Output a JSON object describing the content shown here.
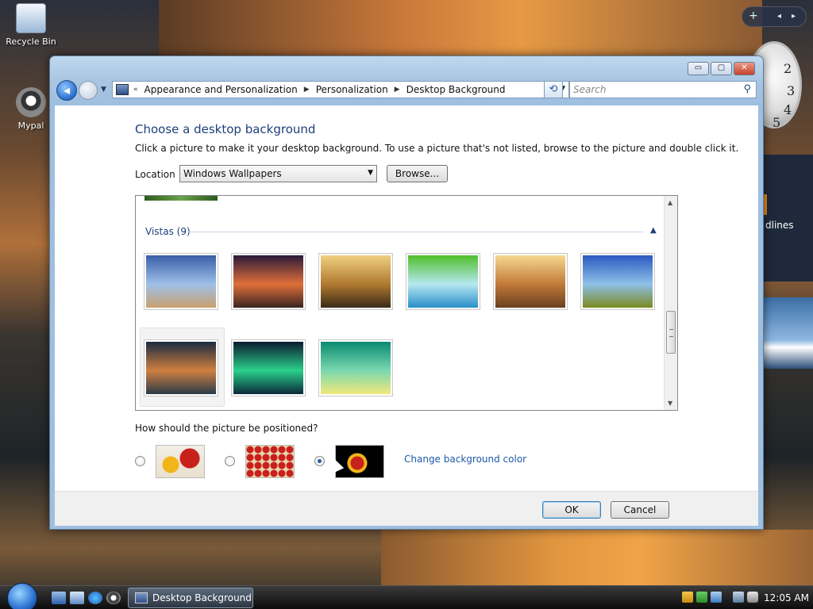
{
  "desktop": {
    "icons": [
      {
        "label": "Recycle Bin"
      },
      {
        "label": "Mypal"
      }
    ],
    "gadgets": {
      "sidebar_controls": [
        "+",
        "◂",
        "▸"
      ],
      "clock_numbers": [
        "2",
        "3",
        "4",
        "5"
      ],
      "feed_text": "dlines"
    }
  },
  "window": {
    "caption_buttons": {
      "minimize": "▭",
      "maximize": "▢",
      "close": "✕"
    },
    "breadcrumb": [
      "Appearance and Personalization",
      "Personalization",
      "Desktop Background"
    ],
    "search_placeholder": "Search",
    "heading": "Choose a desktop background",
    "description": "Click a picture to make it your desktop background. To use a picture that's not listed, browse to the picture and double click it.",
    "location_label": "Location",
    "location_value": "Windows Wallpapers",
    "browse_label": "Browse...",
    "gallery": {
      "group_title": "Vistas (9)",
      "thumbnails": [
        {
          "name": "vista-river-mountains",
          "colors": [
            "#3a5ea8",
            "#9ec0e8",
            "#c9a070"
          ]
        },
        {
          "name": "vista-sunset-hills",
          "colors": [
            "#2a1a3a",
            "#e0703a",
            "#3a2420"
          ]
        },
        {
          "name": "vista-golden-rocks",
          "colors": [
            "#f0d080",
            "#b07a30",
            "#3a2a18"
          ]
        },
        {
          "name": "vista-palm-leaf",
          "colors": [
            "#4fbf2a",
            "#b6e8f0",
            "#2a8ec8"
          ]
        },
        {
          "name": "vista-sun-field",
          "colors": [
            "#f6d890",
            "#c27a3a",
            "#6a4020"
          ]
        },
        {
          "name": "vista-green-hills",
          "colors": [
            "#2a5ac0",
            "#8fc0e8",
            "#7a8a20"
          ]
        },
        {
          "name": "vista-mountain-reflection",
          "colors": [
            "#1a2a40",
            "#d08040",
            "#2a3a48"
          ]
        },
        {
          "name": "vista-aurora",
          "colors": [
            "#0a1a30",
            "#2ad08a",
            "#0a2a3a"
          ]
        },
        {
          "name": "vista-green-glow",
          "colors": [
            "#0a8a70",
            "#7ad8b0",
            "#f0e87a"
          ]
        }
      ]
    },
    "position_label": "How should the picture be positioned?",
    "position_options": [
      {
        "name": "fit",
        "selected": false
      },
      {
        "name": "tile",
        "selected": false
      },
      {
        "name": "center",
        "selected": true
      }
    ],
    "change_color_label": "Change background color",
    "ok_label": "OK",
    "cancel_label": "Cancel"
  },
  "taskbar": {
    "active_window": "Desktop Background",
    "time": "12:05 AM"
  }
}
